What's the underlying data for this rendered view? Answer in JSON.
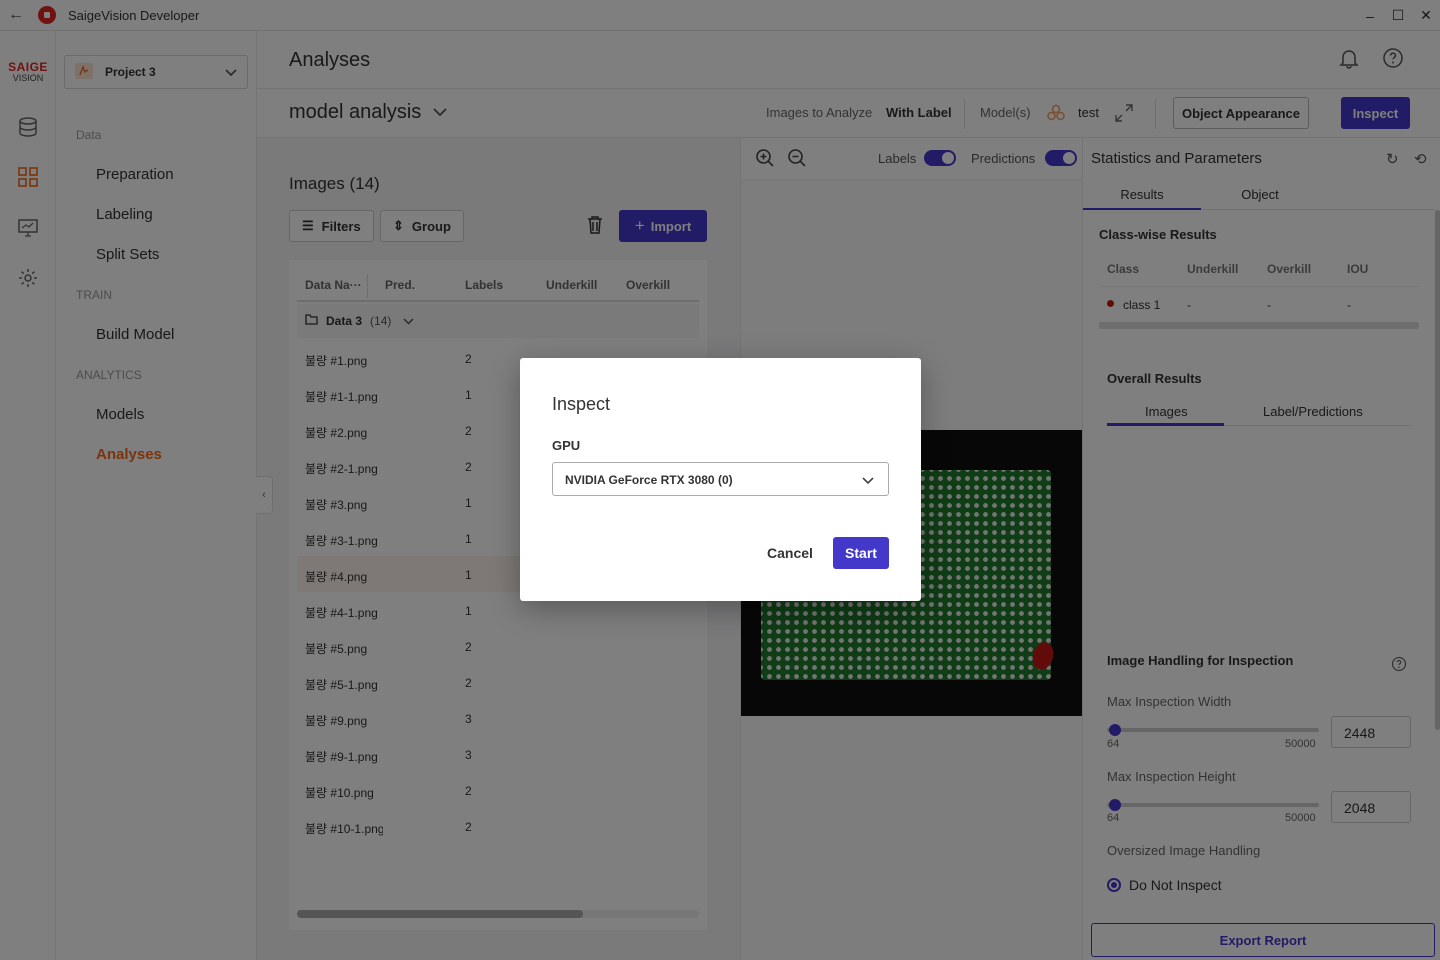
{
  "window": {
    "title": "SaigeVision Developer"
  },
  "brand": {
    "line1": "SAIGE",
    "line2": "VISION"
  },
  "project": {
    "name": "Project 3"
  },
  "nav": {
    "section_data": "Data",
    "preparation": "Preparation",
    "labeling": "Labeling",
    "split_sets": "Split Sets",
    "section_train": "TRAIN",
    "build_model": "Build Model",
    "section_analytics": "ANALYTICS",
    "models": "Models",
    "analyses": "Analyses"
  },
  "header": {
    "title": "Analyses"
  },
  "analysis": {
    "name": "model analysis",
    "images_to_analyze_label": "Images to Analyze",
    "images_to_analyze_value": "With Label",
    "models_label": "Model(s)",
    "models_value": "test",
    "object_appearance_label": "Object Appearance",
    "inspect_label": "Inspect"
  },
  "images": {
    "title": "Images (14)",
    "filters_label": "Filters",
    "group_label": "Group",
    "import_label": "Import",
    "columns": [
      "Data Na···",
      "Pred.",
      "Labels",
      "Underkill",
      "Overkill"
    ],
    "group": {
      "name": "Data 3",
      "count": "(14)"
    },
    "rows": [
      {
        "name": "불량 #1.png",
        "labels": "2"
      },
      {
        "name": "불량 #1-1.png",
        "labels": "1"
      },
      {
        "name": "불량 #2.png",
        "labels": "2"
      },
      {
        "name": "불량 #2-1.png",
        "labels": "2"
      },
      {
        "name": "불량 #3.png",
        "labels": "1"
      },
      {
        "name": "불량 #3-1.png",
        "labels": "1"
      },
      {
        "name": "불량 #4.png",
        "labels": "1"
      },
      {
        "name": "불량 #4-1.png",
        "labels": "1"
      },
      {
        "name": "불량 #5.png",
        "labels": "2"
      },
      {
        "name": "불량 #5-1.png",
        "labels": "2"
      },
      {
        "name": "불량 #9.png",
        "labels": "3"
      },
      {
        "name": "불량 #9-1.png",
        "labels": "3"
      },
      {
        "name": "불량 #10.png",
        "labels": "2"
      },
      {
        "name": "불량 #10-1.png",
        "labels": "2"
      }
    ],
    "selected_index": 6
  },
  "viewer": {
    "labels_toggle": "Labels",
    "predictions_toggle": "Predictions"
  },
  "stats": {
    "title": "Statistics and Parameters",
    "tabs": [
      "Results",
      "Object"
    ],
    "classwise_title": "Class-wise Results",
    "classwise_columns": [
      "Class",
      "Underkill",
      "Overkill",
      "IOU"
    ],
    "classwise_rows": [
      {
        "class": "class 1",
        "underkill": "-",
        "overkill": "-",
        "iou": "-"
      }
    ],
    "overall_title": "Overall Results",
    "overall_tabs": [
      "Images",
      "Label/Predictions"
    ],
    "handling_title": "Image Handling for Inspection",
    "max_width_label": "Max Inspection Width",
    "max_width_min": "64",
    "max_width_max": "50000",
    "max_width_value": "2448",
    "max_height_label": "Max Inspection Height",
    "max_height_min": "64",
    "max_height_max": "50000",
    "max_height_value": "2048",
    "oversized_label": "Oversized Image Handling",
    "oversized_option": "Do Not Inspect",
    "export_label": "Export Report"
  },
  "modal": {
    "title": "Inspect",
    "gpu_label": "GPU",
    "gpu_value": "NVIDIA GeForce RTX 3080 (0)",
    "cancel_label": "Cancel",
    "start_label": "Start"
  },
  "colors": {
    "accent": "#4338ca",
    "brand": "#e02424",
    "active_nav": "#f26a1b"
  }
}
